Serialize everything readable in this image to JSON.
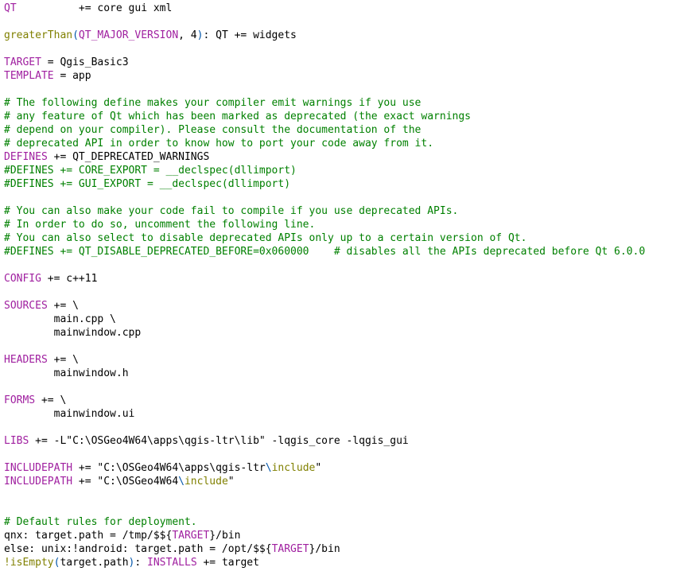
{
  "editor": {
    "language": "qmake-project",
    "filename": "Qgis_Basic3.pro",
    "background_color": "#ffffff",
    "font_size_px": 13,
    "line_height_px": 17,
    "colors": {
      "keyword": "#a020a0",
      "comment": "#008000",
      "function": "#808000",
      "paren": "#0055aa",
      "escape": "#808000",
      "text": "#000000"
    }
  },
  "lines": [
    {
      "n": 1,
      "segments": [
        {
          "t": "QT",
          "c": "kw"
        },
        {
          "t": "          += core gui xml",
          "c": "tx"
        }
      ]
    },
    {
      "n": 2,
      "segments": []
    },
    {
      "n": 3,
      "segments": [
        {
          "t": "greaterThan",
          "c": "fn"
        },
        {
          "t": "(",
          "c": "pn"
        },
        {
          "t": "QT_MAJOR_VERSION",
          "c": "kw"
        },
        {
          "t": ", 4",
          "c": "tx"
        },
        {
          "t": ")",
          "c": "pn"
        },
        {
          "t": ": QT += widgets",
          "c": "tx"
        }
      ]
    },
    {
      "n": 4,
      "segments": []
    },
    {
      "n": 5,
      "segments": [
        {
          "t": "TARGET",
          "c": "kw"
        },
        {
          "t": " = Qgis_Basic3",
          "c": "tx"
        }
      ]
    },
    {
      "n": 6,
      "segments": [
        {
          "t": "TEMPLATE",
          "c": "kw"
        },
        {
          "t": " = app",
          "c": "tx"
        }
      ]
    },
    {
      "n": 7,
      "segments": []
    },
    {
      "n": 8,
      "segments": [
        {
          "t": "# The following define makes your compiler emit warnings if you use",
          "c": "cm"
        }
      ]
    },
    {
      "n": 9,
      "segments": [
        {
          "t": "# any feature of Qt which has been marked as deprecated (the exact warnings",
          "c": "cm"
        }
      ]
    },
    {
      "n": 10,
      "segments": [
        {
          "t": "# depend on your compiler). Please consult the documentation of the",
          "c": "cm"
        }
      ]
    },
    {
      "n": 11,
      "segments": [
        {
          "t": "# deprecated API in order to know how to port your code away from it.",
          "c": "cm"
        }
      ]
    },
    {
      "n": 12,
      "segments": [
        {
          "t": "DEFINES",
          "c": "kw"
        },
        {
          "t": " += QT_DEPRECATED_WARNINGS",
          "c": "tx"
        }
      ]
    },
    {
      "n": 13,
      "segments": [
        {
          "t": "#DEFINES += CORE_EXPORT = __declspec(dllimport)",
          "c": "cm"
        }
      ]
    },
    {
      "n": 14,
      "segments": [
        {
          "t": "#DEFINES += GUI_EXPORT = __declspec(dllimport)",
          "c": "cm"
        }
      ]
    },
    {
      "n": 15,
      "segments": []
    },
    {
      "n": 16,
      "segments": [
        {
          "t": "# You can also make your code fail to compile if you use deprecated APIs.",
          "c": "cm"
        }
      ]
    },
    {
      "n": 17,
      "segments": [
        {
          "t": "# In order to do so, uncomment the following line.",
          "c": "cm"
        }
      ]
    },
    {
      "n": 18,
      "segments": [
        {
          "t": "# You can also select to disable deprecated APIs only up to a certain version of Qt.",
          "c": "cm"
        }
      ]
    },
    {
      "n": 19,
      "segments": [
        {
          "t": "#DEFINES += QT_DISABLE_DEPRECATED_BEFORE=0x060000    # disables all the APIs deprecated before Qt 6.0.0",
          "c": "cm"
        }
      ]
    },
    {
      "n": 20,
      "segments": []
    },
    {
      "n": 21,
      "segments": [
        {
          "t": "CONFIG",
          "c": "kw"
        },
        {
          "t": " += c++11",
          "c": "tx"
        }
      ]
    },
    {
      "n": 22,
      "segments": []
    },
    {
      "n": 23,
      "segments": [
        {
          "t": "SOURCES",
          "c": "kw"
        },
        {
          "t": " += \\",
          "c": "tx"
        }
      ]
    },
    {
      "n": 24,
      "segments": [
        {
          "t": "        main.cpp \\",
          "c": "tx"
        }
      ]
    },
    {
      "n": 25,
      "segments": [
        {
          "t": "        mainwindow.cpp",
          "c": "tx"
        }
      ]
    },
    {
      "n": 26,
      "segments": []
    },
    {
      "n": 27,
      "segments": [
        {
          "t": "HEADERS",
          "c": "kw"
        },
        {
          "t": " += \\",
          "c": "tx"
        }
      ]
    },
    {
      "n": 28,
      "segments": [
        {
          "t": "        mainwindow.h",
          "c": "tx"
        }
      ]
    },
    {
      "n": 29,
      "segments": []
    },
    {
      "n": 30,
      "segments": [
        {
          "t": "FORMS",
          "c": "kw"
        },
        {
          "t": " += \\",
          "c": "tx"
        }
      ]
    },
    {
      "n": 31,
      "segments": [
        {
          "t": "        mainwindow.ui",
          "c": "tx"
        }
      ]
    },
    {
      "n": 32,
      "segments": []
    },
    {
      "n": 33,
      "segments": [
        {
          "t": "LIBS",
          "c": "kw"
        },
        {
          "t": " += -L\"C:\\OSGeo4W64\\apps\\qgis-ltr\\lib\" -lqgis_core -lqgis_gui",
          "c": "tx"
        }
      ]
    },
    {
      "n": 34,
      "segments": []
    },
    {
      "n": 35,
      "segments": [
        {
          "t": "INCLUDEPATH",
          "c": "kw"
        },
        {
          "t": " += \"C:\\OSGeo4W64\\apps\\qgis-ltr",
          "c": "tx"
        },
        {
          "t": "\\",
          "c": "bs"
        },
        {
          "t": "include",
          "c": "esc"
        },
        {
          "t": "\"",
          "c": "tx"
        }
      ]
    },
    {
      "n": 36,
      "segments": [
        {
          "t": "INCLUDEPATH",
          "c": "kw"
        },
        {
          "t": " += \"C:\\OSGeo4W64",
          "c": "tx"
        },
        {
          "t": "\\",
          "c": "bs"
        },
        {
          "t": "include",
          "c": "esc"
        },
        {
          "t": "\"",
          "c": "tx"
        }
      ]
    },
    {
      "n": 37,
      "segments": []
    },
    {
      "n": 38,
      "segments": []
    },
    {
      "n": 39,
      "segments": [
        {
          "t": "# Default rules for deployment.",
          "c": "cm"
        }
      ]
    },
    {
      "n": 40,
      "segments": [
        {
          "t": "qnx: target.path = /tmp/$$",
          "c": "tx"
        },
        {
          "t": "{",
          "c": "tx"
        },
        {
          "t": "TARGET",
          "c": "kw"
        },
        {
          "t": "}",
          "c": "tx"
        },
        {
          "t": "/bin",
          "c": "tx"
        }
      ]
    },
    {
      "n": 41,
      "segments": [
        {
          "t": "else: unix:!android: target.path = /opt/$$",
          "c": "tx"
        },
        {
          "t": "{",
          "c": "tx"
        },
        {
          "t": "TARGET",
          "c": "kw"
        },
        {
          "t": "}",
          "c": "tx"
        },
        {
          "t": "/bin",
          "c": "tx"
        }
      ]
    },
    {
      "n": 42,
      "segments": [
        {
          "t": "!isEmpty",
          "c": "fn"
        },
        {
          "t": "(",
          "c": "pn"
        },
        {
          "t": "target.path",
          "c": "tx"
        },
        {
          "t": ")",
          "c": "pn"
        },
        {
          "t": ": ",
          "c": "tx"
        },
        {
          "t": "INSTALLS",
          "c": "kw"
        },
        {
          "t": " += target",
          "c": "tx"
        }
      ]
    }
  ]
}
